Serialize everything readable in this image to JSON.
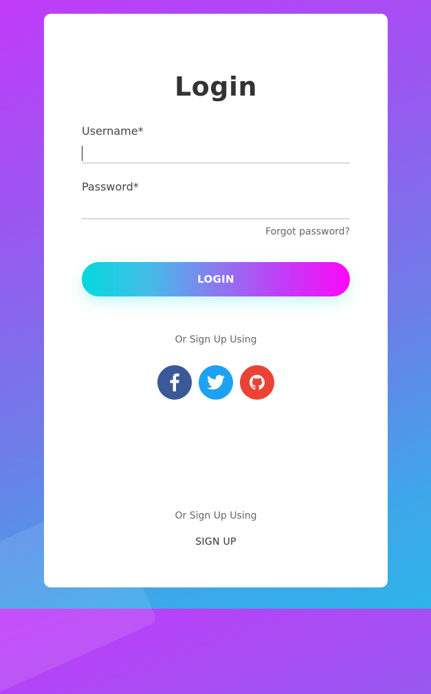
{
  "colors": {
    "card_background": "#ffffff",
    "button_gradient_start": "#04d9dc",
    "button_gradient_end": "#fb09f8",
    "facebook": "#3b5998",
    "twitter": "#1da1f2",
    "github": "#ea4335"
  },
  "login_form": {
    "title": "Login",
    "username_label": "Username*",
    "username_value": "",
    "password_label": "Password*",
    "password_value": "",
    "forgot_password": "Forgot password?",
    "login_button": "LOGIN",
    "alt_signup_text": "Or Sign Up Using",
    "social_buttons": [
      {
        "name": "facebook",
        "icon": "facebook-icon"
      },
      {
        "name": "twitter",
        "icon": "twitter-icon"
      },
      {
        "name": "github",
        "icon": "github-icon"
      }
    ],
    "alt_signup_text_2": "Or Sign Up Using",
    "signup_link": "SIGN UP"
  }
}
